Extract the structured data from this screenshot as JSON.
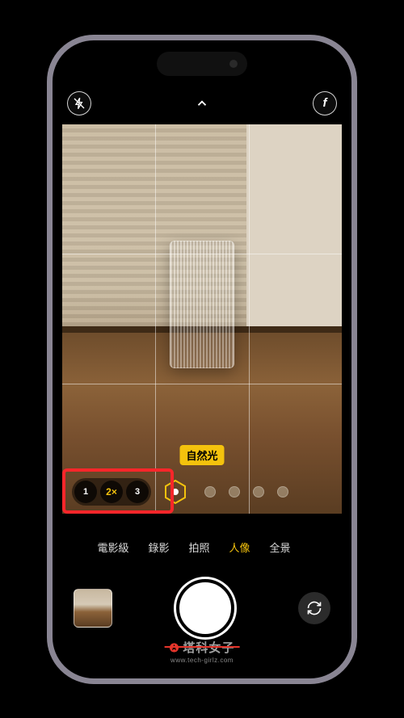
{
  "top_controls": {
    "flash": "flash-off-icon",
    "chevron": "chevron-up-icon",
    "filter": "f"
  },
  "lighting_label": "自然光",
  "zoom": {
    "options": [
      "1",
      "2×",
      "3"
    ],
    "active_index": 1
  },
  "modes": {
    "items": [
      "電影級",
      "錄影",
      "拍照",
      "人像",
      "全景"
    ],
    "partial_left": "電影級",
    "active_index": 3
  },
  "watermark": {
    "brand": "塔科女子",
    "sub": "www.tech-girlz.com"
  },
  "icons": {
    "flip": "camera-flip-icon",
    "shutter": "shutter-button",
    "thumbnail": "last-photo-thumbnail",
    "hexagon": "portrait-lighting-hexagon-icon"
  }
}
